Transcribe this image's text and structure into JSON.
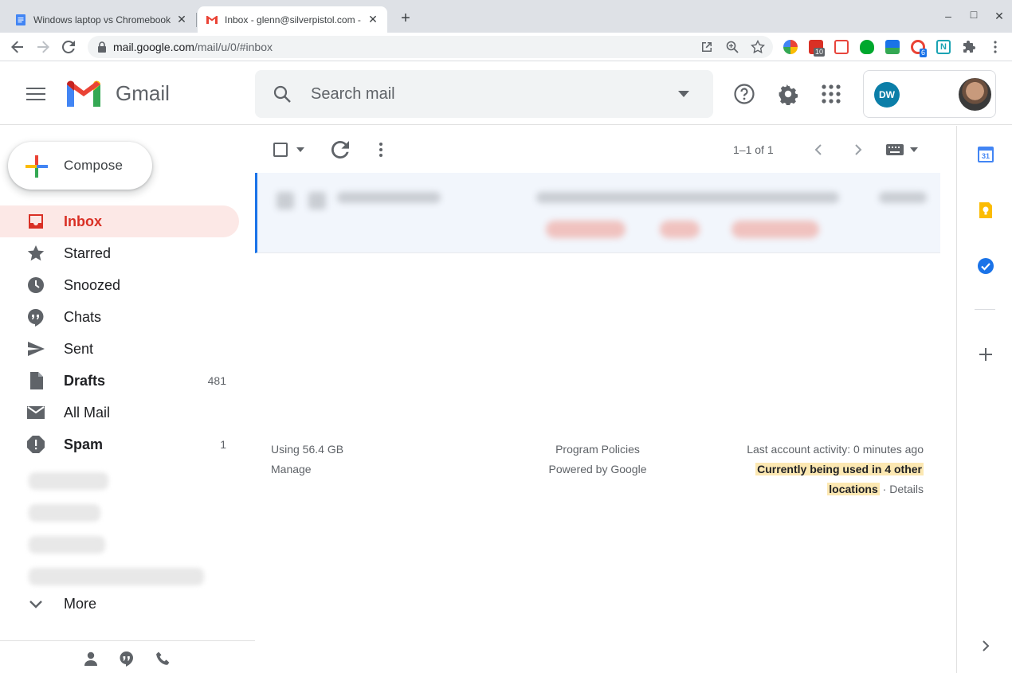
{
  "browser": {
    "tabs": [
      {
        "title": "Windows laptop vs Chromebook",
        "active": false
      },
      {
        "title": "Inbox - glenn@silverpistol.com -",
        "active": true
      }
    ],
    "new_tab": "+",
    "window_controls": {
      "minimize": "–",
      "maximize": "□",
      "close": "✕"
    },
    "url_host": "mail.google.com",
    "url_path": "/mail/u/0/#inbox",
    "extensions": [
      {
        "name": "color-picker-ext",
        "color": "#ea4335"
      },
      {
        "name": "calendar-ext",
        "color": "#d93025",
        "badge": "10"
      },
      {
        "name": "chart-ext",
        "color": "#e8453c"
      },
      {
        "name": "evernote-ext",
        "color": "#00a82d"
      },
      {
        "name": "photo-ext",
        "color": "#1a73e8"
      },
      {
        "name": "target-ext",
        "color": "#ea4335",
        "badge": "6"
      },
      {
        "name": "n-ext",
        "color": "#1aa3b3"
      }
    ]
  },
  "gmail": {
    "logo_text": "Gmail",
    "search_placeholder": "Search mail",
    "account_initials": "DW"
  },
  "sidebar": {
    "compose": "Compose",
    "items": [
      {
        "label": "Inbox",
        "icon": "inbox-icon",
        "count": "",
        "active": true,
        "bold": true
      },
      {
        "label": "Starred",
        "icon": "star-icon",
        "count": ""
      },
      {
        "label": "Snoozed",
        "icon": "clock-icon",
        "count": ""
      },
      {
        "label": "Chats",
        "icon": "chat-icon",
        "count": ""
      },
      {
        "label": "Sent",
        "icon": "send-icon",
        "count": ""
      },
      {
        "label": "Drafts",
        "icon": "draft-icon",
        "count": "481",
        "bold": true
      },
      {
        "label": "All Mail",
        "icon": "mail-icon",
        "count": ""
      },
      {
        "label": "Spam",
        "icon": "spam-icon",
        "count": "1",
        "bold": true
      }
    ],
    "more": "More"
  },
  "main": {
    "pager": "1–1 of 1",
    "footer": {
      "storage": "Using 56.4 GB",
      "manage": "Manage",
      "policies": "Program Policies",
      "powered": "Powered by Google",
      "activity": "Last account activity: 0 minutes ago",
      "locations_1": "Currently being used in 4 other",
      "locations_2": "locations",
      "dot": " · ",
      "details": "Details"
    }
  },
  "colors": {
    "accent": "#d93025",
    "blue": "#1a73e8",
    "highlight": "#fce8b2"
  }
}
